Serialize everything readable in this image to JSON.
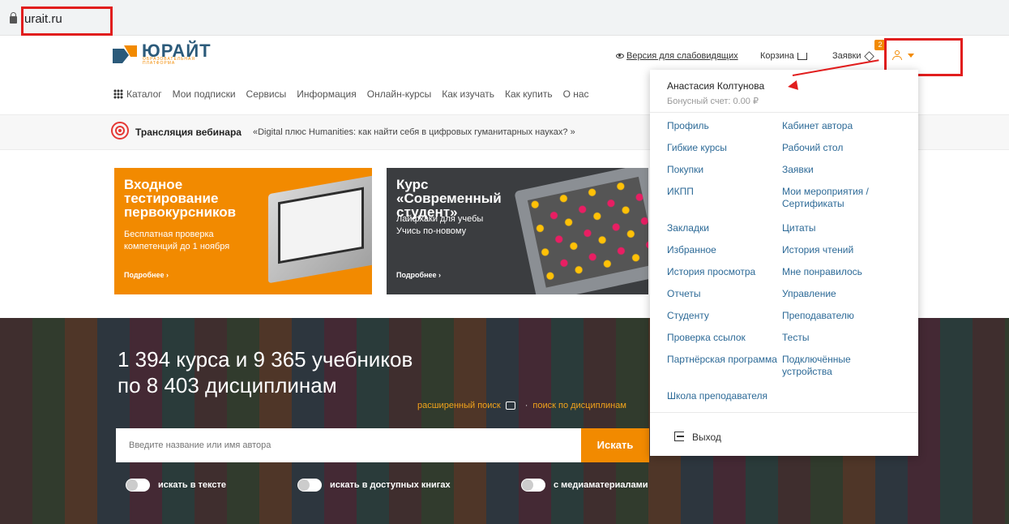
{
  "browser": {
    "url": "urait.ru"
  },
  "header": {
    "logo_name": "ЮРАЙТ",
    "logo_sub": "ОБРАЗОВАТЕЛЬНАЯ ПЛАТФОРМА",
    "low_vision": "Версия для слабовидящих",
    "cart": "Корзина",
    "requests": "Заявки",
    "requests_badge": "2"
  },
  "nav": {
    "catalog": "Каталог",
    "items": [
      "Мои подписки",
      "Сервисы",
      "Информация",
      "Онлайн-курсы",
      "Как изучать",
      "Как купить",
      "О нас"
    ]
  },
  "webinar": {
    "title": "Трансляция вебинара",
    "text": "«Digital плюс Humanities: как найти себя в цифровых гуманитарных науках? »"
  },
  "cards": [
    {
      "title": "Входное тестирование первокурсников",
      "text": "Бесплатная проверка компетенций до 1 ноября",
      "more": "Подробнее ›"
    },
    {
      "title": "Курс «Современный студент»",
      "text": "Лайфхаки для учебы Учись по-новому",
      "more": "Подробнее ›"
    }
  ],
  "hero": {
    "title_line1": "1 394 курса и 9 365 учебников",
    "title_line2": "по 8 403 дисциплинам",
    "advanced_search": "расширенный поиск",
    "discipline_search": "поиск по дисциплинам",
    "search_placeholder": "Введите название или имя автора",
    "search_button": "Искать",
    "toggles": [
      "искать в тексте",
      "искать в доступных книгах",
      "с медиаматериалами"
    ]
  },
  "dropdown": {
    "user_name": "Анастасия Колтунова",
    "bonus": "Бонусный счет: 0.00 ₽",
    "left_items": [
      "Профиль",
      "Гибкие курсы",
      "Покупки",
      "ИКПП",
      "Закладки",
      "Избранное",
      "История просмотра",
      "Отчеты",
      "Студенту",
      "Проверка ссылок",
      "Партнёрская программа",
      "Школа преподавателя"
    ],
    "right_items": [
      "Кабинет автора",
      "Рабочий стол",
      "Заявки",
      "Мои мероприятия / Сертификаты",
      "Цитаты",
      "История чтений",
      "Мне понравилось",
      "Управление",
      "Преподавателю",
      "Тесты",
      "Подключённые устройства"
    ],
    "logout": "Выход"
  },
  "colors": {
    "accent": "#f28a00",
    "link": "#2d6a97",
    "annotation": "#e11d1d"
  }
}
